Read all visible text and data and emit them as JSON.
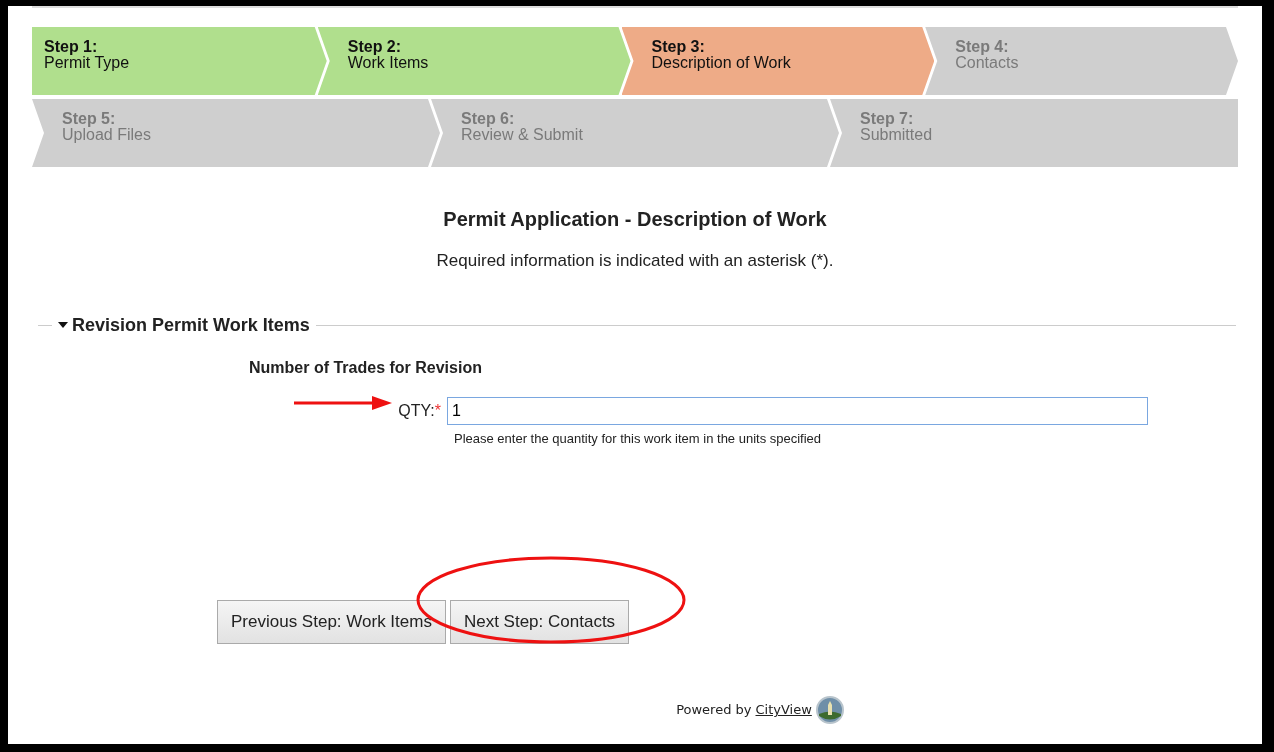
{
  "steps": [
    {
      "number": "Step 1:",
      "title": "Permit Type",
      "completed": true,
      "selected": false
    },
    {
      "number": "Step 2:",
      "title": "Work Items",
      "completed": true,
      "selected": false
    },
    {
      "number": "Step 3:",
      "title": "Description of Work",
      "completed": false,
      "selected": true
    },
    {
      "number": "Step 4:",
      "title": "Contacts",
      "completed": false,
      "selected": false
    },
    {
      "number": "Step 5:",
      "title": "Upload Files",
      "completed": false,
      "selected": false
    },
    {
      "number": "Step 6:",
      "title": "Review & Submit",
      "completed": false,
      "selected": false
    },
    {
      "number": "Step 7:",
      "title": "Submitted",
      "completed": false,
      "selected": false
    }
  ],
  "heading": "Permit Application - Description of Work",
  "subheading": "Required information is indicated with an asterisk (*).",
  "section": {
    "title": "Revision Permit Work Items",
    "expanded": true,
    "group_title": "Number of Trades for Revision",
    "field": {
      "label": "QTY:",
      "required_mark": "*",
      "value": "1",
      "focused": true,
      "help": "Please enter the quantity for this work item in the units specified"
    }
  },
  "buttons": [
    "Previous Step: Work Items",
    "Next Step: Contacts"
  ],
  "footer": {
    "prefix": "Powered by",
    "link": "CityView"
  }
}
